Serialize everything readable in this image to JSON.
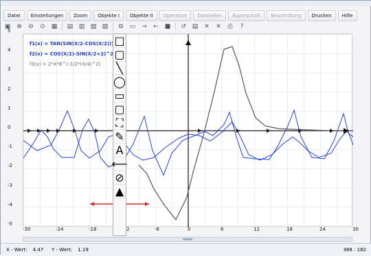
{
  "menu": [
    {
      "label": "Datei"
    },
    {
      "label": "Einstellungen"
    },
    {
      "label": "Zoom"
    },
    {
      "label": "Objekte I"
    },
    {
      "label": "Objekte II"
    },
    {
      "label": "Operation",
      "disabled": true
    },
    {
      "label": "Darstellen",
      "disabled": true
    },
    {
      "label": "Eigenschaft",
      "disabled": true
    },
    {
      "label": "Beschriftung",
      "disabled": true
    },
    {
      "label": "Drucken"
    },
    {
      "label": "Hilfe"
    }
  ],
  "legend": [
    {
      "text": "f1(x) = TAN(SIN(X/2-COS(X/2)))"
    },
    {
      "text": "f2(x) = COS(X/2)-SIN(X/2+2)^2"
    },
    {
      "text": "f3(x) = 2*X*E^(-1/2*(X/4)^2)"
    }
  ],
  "axes": {
    "x_ticks": [
      "-30",
      "-24",
      "-18",
      "-12",
      "-6",
      "0",
      "6",
      "12",
      "18",
      "24",
      "30"
    ],
    "y_ticks": [
      "5",
      "4",
      "3",
      "2",
      "1",
      "0",
      "-1",
      "-2",
      "-3",
      "-4",
      "-5"
    ]
  },
  "status": {
    "xlabel": "X - Wert:",
    "xval": "4.47",
    "ylabel": "Y - Wert:",
    "yval": "1.19",
    "coords": "388 : 182"
  }
}
